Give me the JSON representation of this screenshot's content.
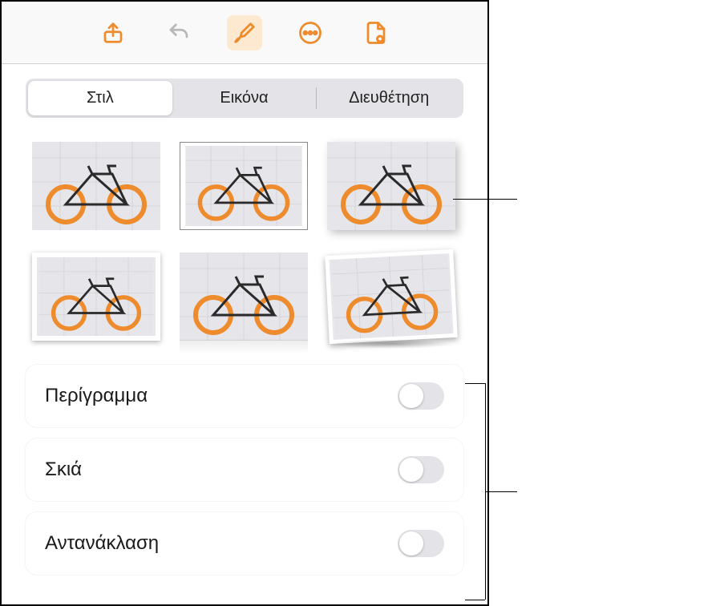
{
  "toolbar": {
    "icons": {
      "share": "share-icon",
      "undo": "undo-icon",
      "format": "brush-icon",
      "more": "more-icon",
      "document": "document-icon"
    }
  },
  "tabs": {
    "style": "Στιλ",
    "image": "Εικόνα",
    "arrange": "Διευθέτηση"
  },
  "toggles": {
    "border": {
      "label": "Περίγραμμα",
      "on": false
    },
    "shadow": {
      "label": "Σκιά",
      "on": false
    },
    "reflection": {
      "label": "Αντανάκλαση",
      "on": false
    }
  },
  "colors": {
    "accent": "#ee8b2d"
  }
}
